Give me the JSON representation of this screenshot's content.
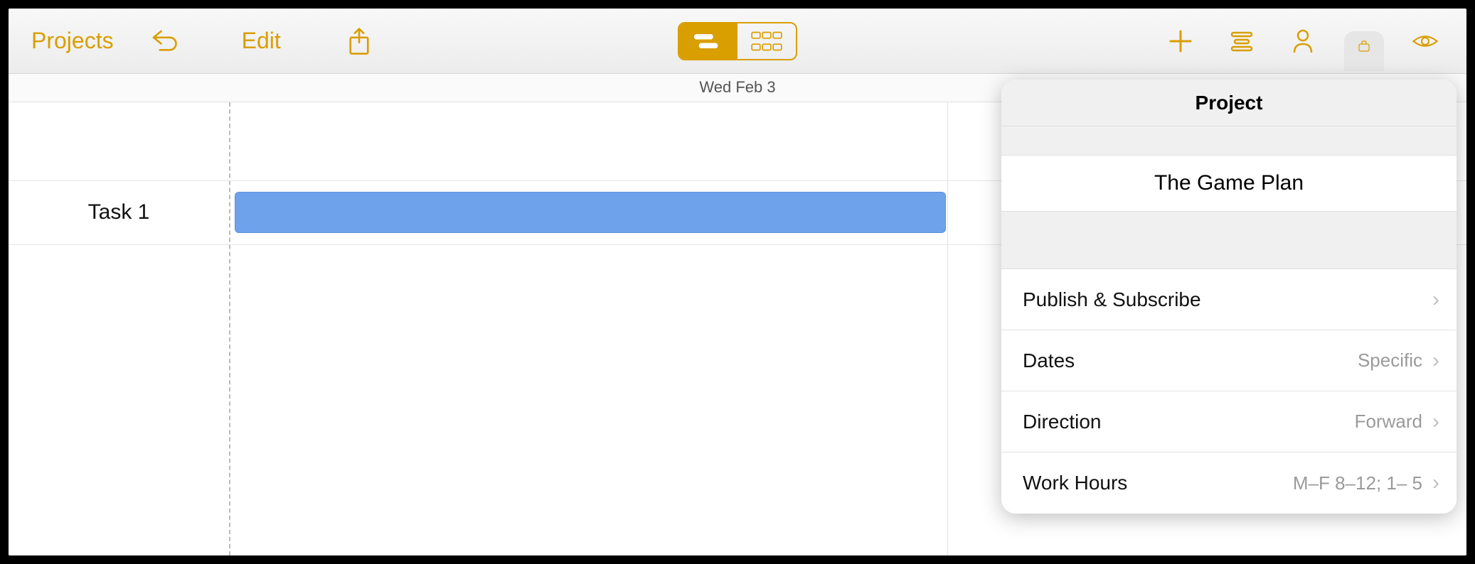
{
  "toolbar": {
    "projects_label": "Projects",
    "edit_label": "Edit"
  },
  "date_header": "Wed Feb 3",
  "task": {
    "name": "Task 1"
  },
  "popover": {
    "title": "Project",
    "project_name": "The Game Plan",
    "rows": {
      "publish": {
        "label": "Publish & Subscribe",
        "value": ""
      },
      "dates": {
        "label": "Dates",
        "value": "Specific"
      },
      "direction": {
        "label": "Direction",
        "value": "Forward"
      },
      "work_hours": {
        "label": "Work Hours",
        "value": "M–F  8–12; 1– 5"
      }
    }
  },
  "colors": {
    "accent": "#d99e00",
    "task_bar": "#6ea3eb"
  }
}
